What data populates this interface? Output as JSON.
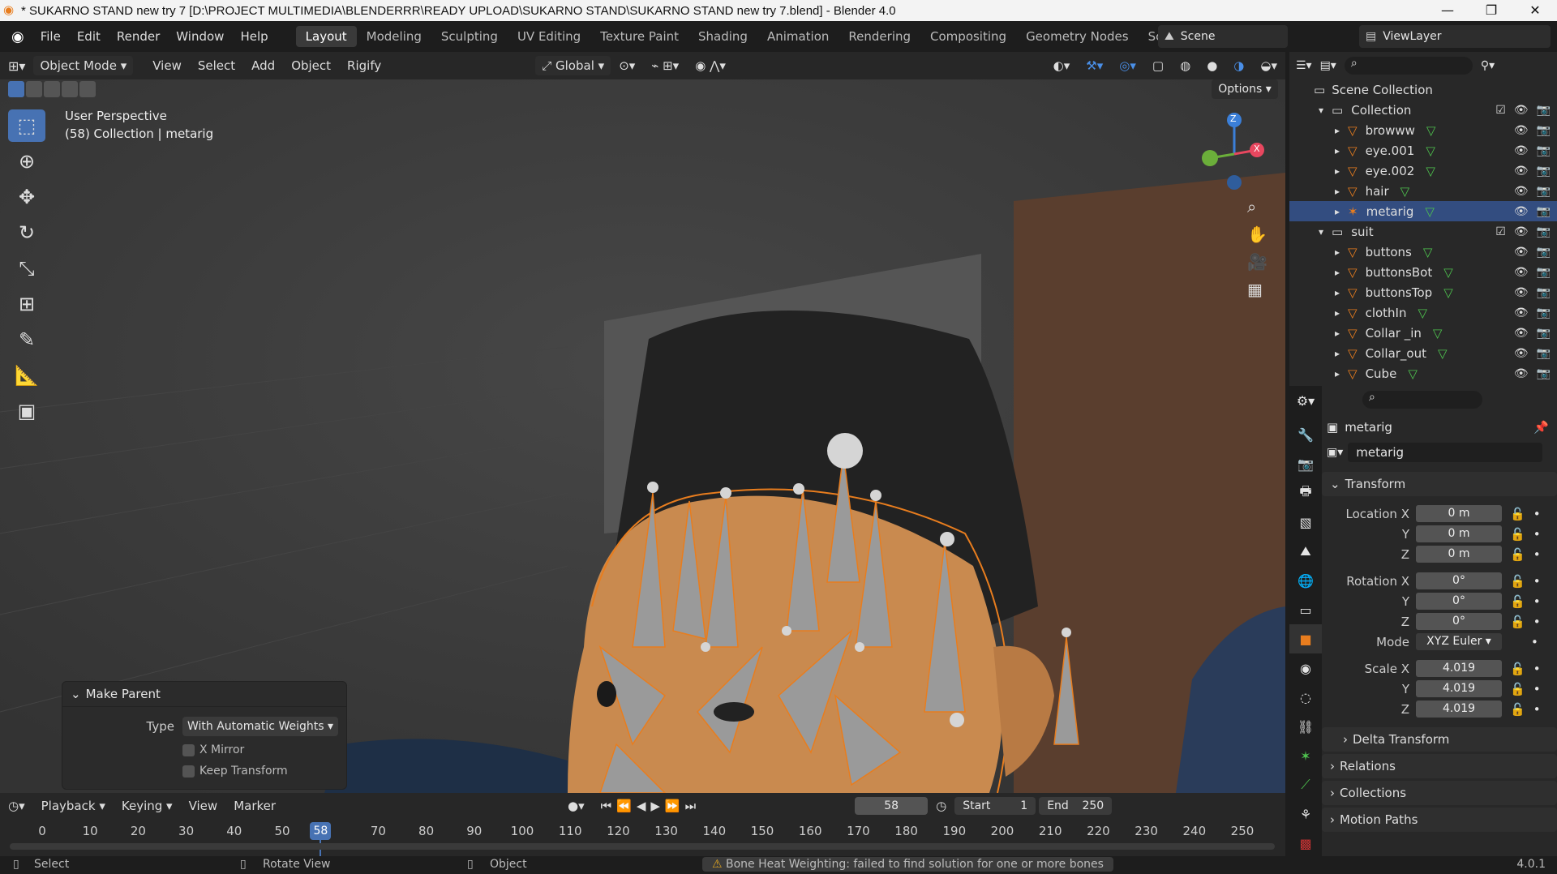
{
  "window": {
    "title": "* SUKARNO STAND new try 7 [D:\\PROJECT MULTIMEDIA\\BLENDERRR\\READY UPLOAD\\SUKARNO STAND\\SUKARNO STAND new try 7.blend] - Blender 4.0"
  },
  "menu": [
    "File",
    "Edit",
    "Render",
    "Window",
    "Help"
  ],
  "workspaces": [
    "Layout",
    "Modeling",
    "Sculpting",
    "UV Editing",
    "Texture Paint",
    "Shading",
    "Animation",
    "Rendering",
    "Compositing",
    "Geometry Nodes",
    "Scripting"
  ],
  "scene": {
    "label": "Scene",
    "view_layer": "ViewLayer"
  },
  "viewport_header": {
    "mode": "Object Mode",
    "items": [
      "View",
      "Select",
      "Add",
      "Object",
      "Rigify"
    ],
    "orientation": "Global",
    "options": "Options"
  },
  "viewport": {
    "perspective": "User Perspective",
    "context": "(58) Collection | metarig",
    "gizmo": {
      "z": "Z",
      "x": "X"
    }
  },
  "outliner": {
    "root": "Scene Collection",
    "rows": [
      {
        "name": "Collection",
        "type": "collection"
      },
      {
        "name": "browww",
        "type": "mesh"
      },
      {
        "name": "eye.001",
        "type": "mesh"
      },
      {
        "name": "eye.002",
        "type": "mesh"
      },
      {
        "name": "hair",
        "type": "mesh"
      },
      {
        "name": "metarig",
        "type": "armature",
        "selected": true
      },
      {
        "name": "suit",
        "type": "collection"
      },
      {
        "name": "buttons",
        "type": "mesh"
      },
      {
        "name": "buttonsBot",
        "type": "mesh"
      },
      {
        "name": "buttonsTop",
        "type": "mesh"
      },
      {
        "name": "clothIn",
        "type": "mesh"
      },
      {
        "name": "Collar _in",
        "type": "mesh"
      },
      {
        "name": "Collar_out",
        "type": "mesh"
      },
      {
        "name": "Cube",
        "type": "mesh"
      }
    ]
  },
  "properties": {
    "object_name": "metarig",
    "data_name": "metarig",
    "transform_label": "Transform",
    "location": {
      "label": "Location X",
      "y_label": "Y",
      "z_label": "Z",
      "x": "0 m",
      "y": "0 m",
      "z": "0 m"
    },
    "rotation": {
      "label": "Rotation X",
      "y_label": "Y",
      "z_label": "Z",
      "x": "0°",
      "y": "0°",
      "z": "0°"
    },
    "mode": {
      "label": "Mode",
      "value": "XYZ Euler"
    },
    "scale": {
      "label": "Scale X",
      "y_label": "Y",
      "z_label": "Z",
      "x": "4.019",
      "y": "4.019",
      "z": "4.019"
    },
    "sections": [
      "Delta Transform",
      "Relations",
      "Collections",
      "Motion Paths"
    ]
  },
  "make_parent": {
    "title": "Make Parent",
    "type_label": "Type",
    "type_value": "With Automatic Weights",
    "x_mirror": "X Mirror",
    "keep_transform": "Keep Transform"
  },
  "timeline": {
    "menus": [
      "Playback",
      "Keying",
      "View",
      "Marker"
    ],
    "current_frame": "58",
    "start_label": "Start",
    "start": "1",
    "end_label": "End",
    "end": "250",
    "ticks": [
      "0",
      "10",
      "20",
      "30",
      "40",
      "50",
      "70",
      "80",
      "90",
      "100",
      "110",
      "120",
      "130",
      "140",
      "150",
      "160",
      "170",
      "180",
      "190",
      "200",
      "210",
      "220",
      "230",
      "240",
      "250"
    ]
  },
  "status": {
    "left": [
      "Select",
      "Rotate View",
      "Object"
    ],
    "warning": "Bone Heat Weighting: failed to find solution for one or more bones",
    "version": "4.0.1"
  },
  "colors": {
    "accent": "#4772b3",
    "selection": "#334d80",
    "skin": "#c98a4f",
    "orange": "#e87d1e"
  }
}
